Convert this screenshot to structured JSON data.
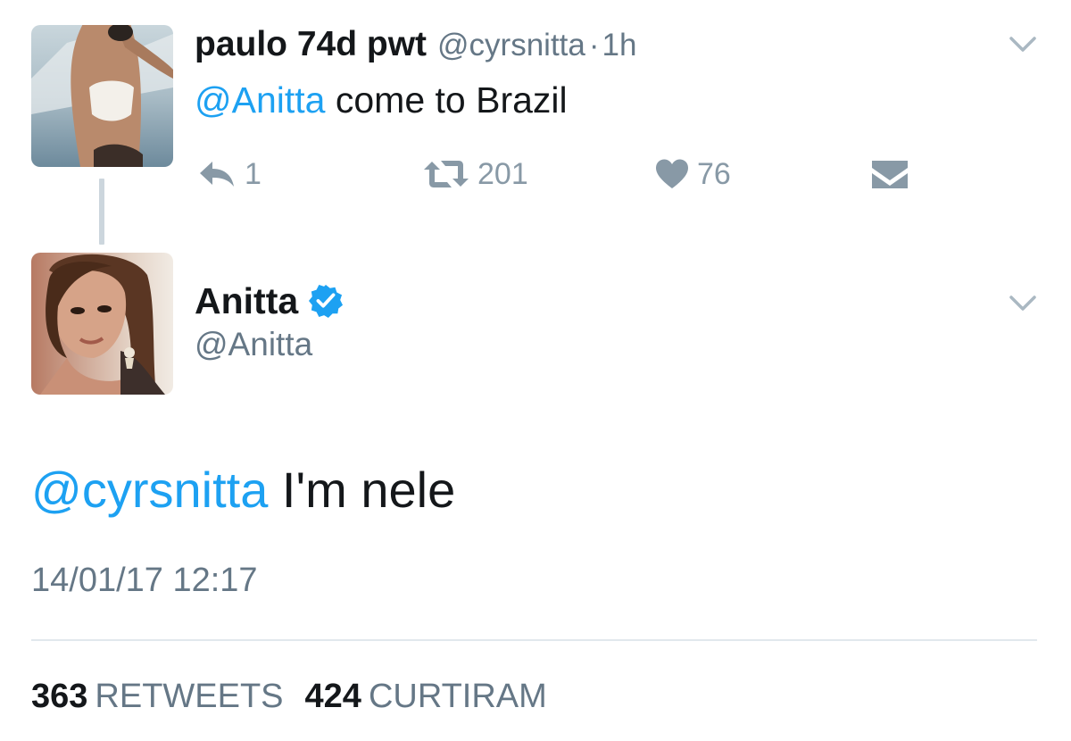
{
  "reply_tweet": {
    "display_name": "paulo 74d pwt",
    "handle": "@cyrsnitta",
    "separator": "·",
    "time_ago": "1h",
    "mention": "@Anitta",
    "text": " come to Brazil",
    "actions": {
      "reply_count": "1",
      "retweet_count": "201",
      "like_count": "76"
    },
    "avatar_icon": "user-photo-avatar",
    "menu_icon": "chevron-down-icon"
  },
  "main_tweet": {
    "display_name": "Anitta",
    "verified_icon": "verified-badge-icon",
    "handle": "@Anitta",
    "mention": "@cyrsnitta",
    "text": " I'm nele",
    "timestamp": "14/01/17 12:17",
    "retweets_count": "363",
    "retweets_label": "RETWEETS",
    "likes_count": "424",
    "likes_label": "CURTIRAM",
    "avatar_icon": "user-photo-avatar",
    "menu_icon": "chevron-down-icon"
  },
  "colors": {
    "link_blue": "#1da1f2",
    "text_primary": "#14171a",
    "text_secondary": "#657786",
    "icon_gray": "#8899a6",
    "divider": "#e1e8ed",
    "thread_line": "#ccd6dd"
  }
}
